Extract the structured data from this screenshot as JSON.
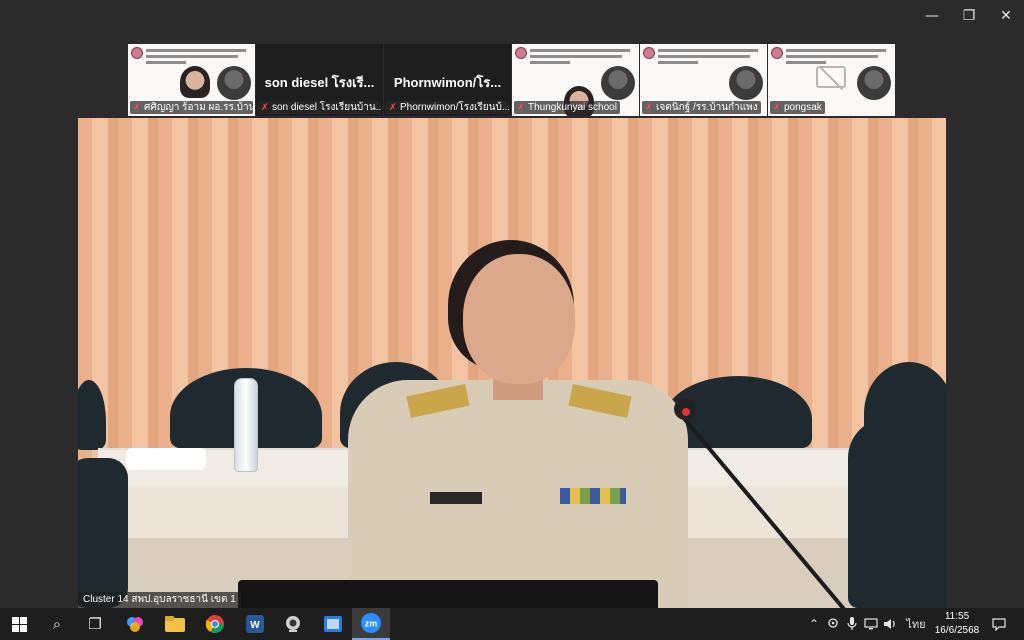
{
  "window": {
    "minimize_glyph": "—",
    "maximize_glyph": "❐",
    "close_glyph": "✕"
  },
  "gallery": [
    {
      "kind": "slide-with-face",
      "label": "ศศิญญา ร้อาม ผอ.รร.บ้าน...",
      "muted": true
    },
    {
      "kind": "dark",
      "name": "son diesel โรงเรี...",
      "label": "son diesel โรงเรียนบ้าน...",
      "muted": true
    },
    {
      "kind": "dark",
      "name": "Phornwimon/โร...",
      "label": "Phornwimon/โรงเรียนบ้...",
      "muted": true
    },
    {
      "kind": "slide-with-face",
      "label": "Thungkunyai school",
      "muted": true
    },
    {
      "kind": "slide",
      "label": "เจตนิกฐ์ /รร.บ้านกำแพง",
      "muted": true
    },
    {
      "kind": "slide-camoff",
      "label": "pongsak",
      "muted": true
    }
  ],
  "main_video": {
    "speaker_label": "Cluster 14 สพป.อุบลราชธานี เขต 1"
  },
  "taskbar": {
    "start_icon": "windows-start-icon",
    "search_glyph": "⌕",
    "taskview_glyph": "❐",
    "tray": {
      "up_glyph": "⌃",
      "language": "ไทย",
      "time": "11:55",
      "date": "16/6/2568",
      "notification_glyph": "🗨"
    }
  },
  "colors": {
    "muted_mic": "#ff4e4e",
    "taskbar_bg": "#1e1e1e",
    "window_bg": "#2b2b2b"
  }
}
